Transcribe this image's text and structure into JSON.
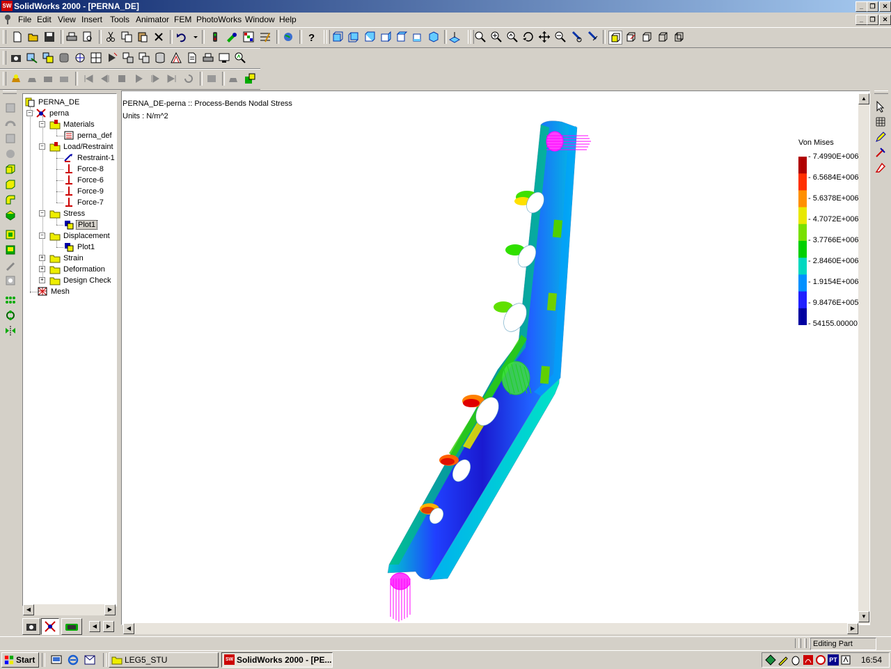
{
  "window": {
    "title": "SolidWorks 2000 - [PERNA_DE]",
    "logo_text": "SW"
  },
  "menu": [
    "File",
    "Edit",
    "View",
    "Insert",
    "Tools",
    "Animator",
    "FEM",
    "PhotoWorks",
    "Window",
    "Help"
  ],
  "tree": {
    "root": "PERNA_DE",
    "part": "perna",
    "materials": "Materials",
    "material_item": "perna_def",
    "loads": "Load/Restraint",
    "load_items": [
      "Restraint-1",
      "Force-8",
      "Force-6",
      "Force-9",
      "Force-7"
    ],
    "stress": "Stress",
    "stress_plot": "Plot1",
    "displacement": "Displacement",
    "displacement_plot": "Plot1",
    "strain": "Strain",
    "deformation": "Deformation",
    "design_check": "Design Check",
    "mesh": "Mesh"
  },
  "viewport": {
    "plot_title": "PERNA_DE-perna :: Process-Bends Nodal Stress",
    "units": "Units : N/m^2"
  },
  "legend": {
    "title": "Von Mises",
    "values": [
      "7.4990E+006",
      "6.5684E+006",
      "5.6378E+006",
      "4.7072E+006",
      "3.7766E+006",
      "2.8460E+006",
      "1.9154E+006",
      "9.8476E+005",
      "54155.00000"
    ],
    "colors": [
      "#b00000",
      "#ff3000",
      "#ff9000",
      "#e8e800",
      "#78e000",
      "#00d000",
      "#00d8c0",
      "#0090ff",
      "#2020ff",
      "#0000a0"
    ]
  },
  "status": {
    "mode": "Editing Part"
  },
  "taskbar": {
    "start": "Start",
    "tasks": [
      "LEG5_STU",
      "SolidWorks 2000 - [PE..."
    ],
    "tray_labels": [
      "PT"
    ],
    "clock": "16:54"
  }
}
